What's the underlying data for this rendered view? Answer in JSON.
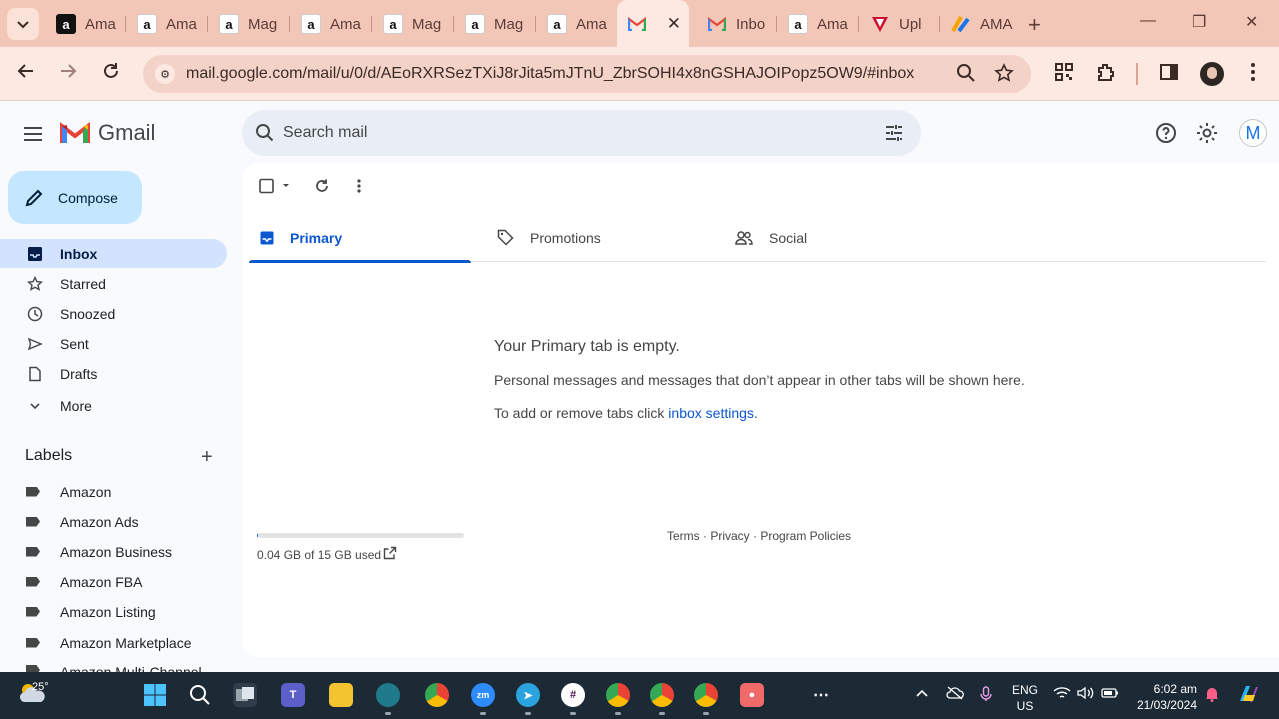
{
  "browser": {
    "tabs": [
      {
        "label": "Ama",
        "icon": "amazon-icon"
      },
      {
        "label": "Ama",
        "icon": "amazon-icon"
      },
      {
        "label": "Mag",
        "icon": "amazon-icon"
      },
      {
        "label": "Ama",
        "icon": "amazon-icon"
      },
      {
        "label": "Mag",
        "icon": "amazon-icon"
      },
      {
        "label": "Mag",
        "icon": "amazon-icon"
      },
      {
        "label": "Ama",
        "icon": "amazon-icon"
      },
      {
        "label": "",
        "icon": "gmail-icon",
        "active": true
      },
      {
        "label": "Inbo",
        "icon": "gmail-icon"
      },
      {
        "label": "Ama",
        "icon": "amazon-icon"
      },
      {
        "label": "Upl",
        "icon": "upload-icon"
      },
      {
        "label": "AMA",
        "icon": "app-icon"
      }
    ],
    "url": "mail.google.com/mail/u/0/d/AEoRXRSezTXiJ8rJita5mJTnU_ZbrSOHI4x8nGSHAJOIPopz5OW9/#inbox"
  },
  "gmail": {
    "logo_text": "Gmail",
    "search_placeholder": "Search mail",
    "avatar_letter": "M",
    "compose_label": "Compose",
    "nav": [
      {
        "label": "Inbox",
        "active": true
      },
      {
        "label": "Starred"
      },
      {
        "label": "Snoozed"
      },
      {
        "label": "Sent"
      },
      {
        "label": "Drafts"
      },
      {
        "label": "More"
      }
    ],
    "labels_title": "Labels",
    "labels": [
      "Amazon",
      "Amazon Ads",
      "Amazon Business",
      "Amazon FBA",
      "Amazon Listing",
      "Amazon Marketplace",
      "Amazon Multi-Channel"
    ],
    "tabs": [
      "Primary",
      "Promotions",
      "Social"
    ],
    "empty": {
      "title": "Your Primary tab is empty.",
      "description": "Personal messages and messages that don’t appear in other tabs will be shown here.",
      "settings_prefix": "To add or remove tabs click ",
      "settings_link": "inbox settings",
      "settings_suffix": "."
    },
    "storage": {
      "text": "0.04 GB of 15 GB used",
      "fraction": 0.003
    },
    "footer": "Terms · Privacy · Program Policies"
  },
  "taskbar": {
    "temperature": "25°",
    "lang_top": "ENG",
    "lang_bottom": "US",
    "time": "6:02 am",
    "date": "21/03/2024"
  },
  "colors": {
    "tabstrip": "#f3c7b8",
    "accent": "#0b57d0",
    "compose_bg": "#c2e7ff",
    "active_nav_bg": "#d3e3fd",
    "taskbar": "#1c2a36"
  }
}
